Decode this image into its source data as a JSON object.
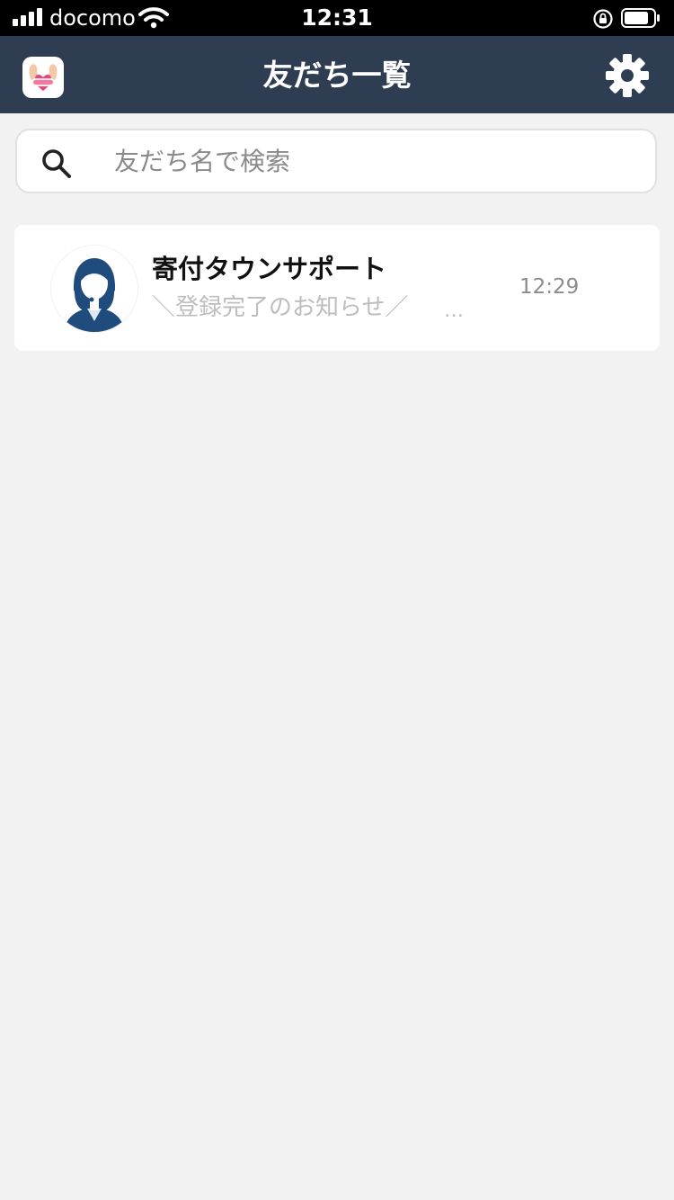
{
  "status_bar": {
    "carrier": "docomo",
    "time": "12:31",
    "icons": [
      "signal-icon",
      "wifi-icon",
      "orientation-lock-icon",
      "battery-icon"
    ]
  },
  "nav": {
    "title": "友だち一覧",
    "logo_icon": "app-logo-icon",
    "settings_icon": "gear-icon"
  },
  "search": {
    "placeholder": "友だち名で検索",
    "value": "",
    "icon": "search-icon"
  },
  "friends": [
    {
      "name": "寄付タウンサポート",
      "preview": "＼登録完了のお知らせ／",
      "ellipsis": "…",
      "time": "12:29",
      "avatar_icon": "support-operator-avatar"
    }
  ],
  "colors": {
    "nav_bg": "#2e3d52",
    "page_bg": "#f2f2f2",
    "avatar_navy": "#1f4b7d"
  }
}
